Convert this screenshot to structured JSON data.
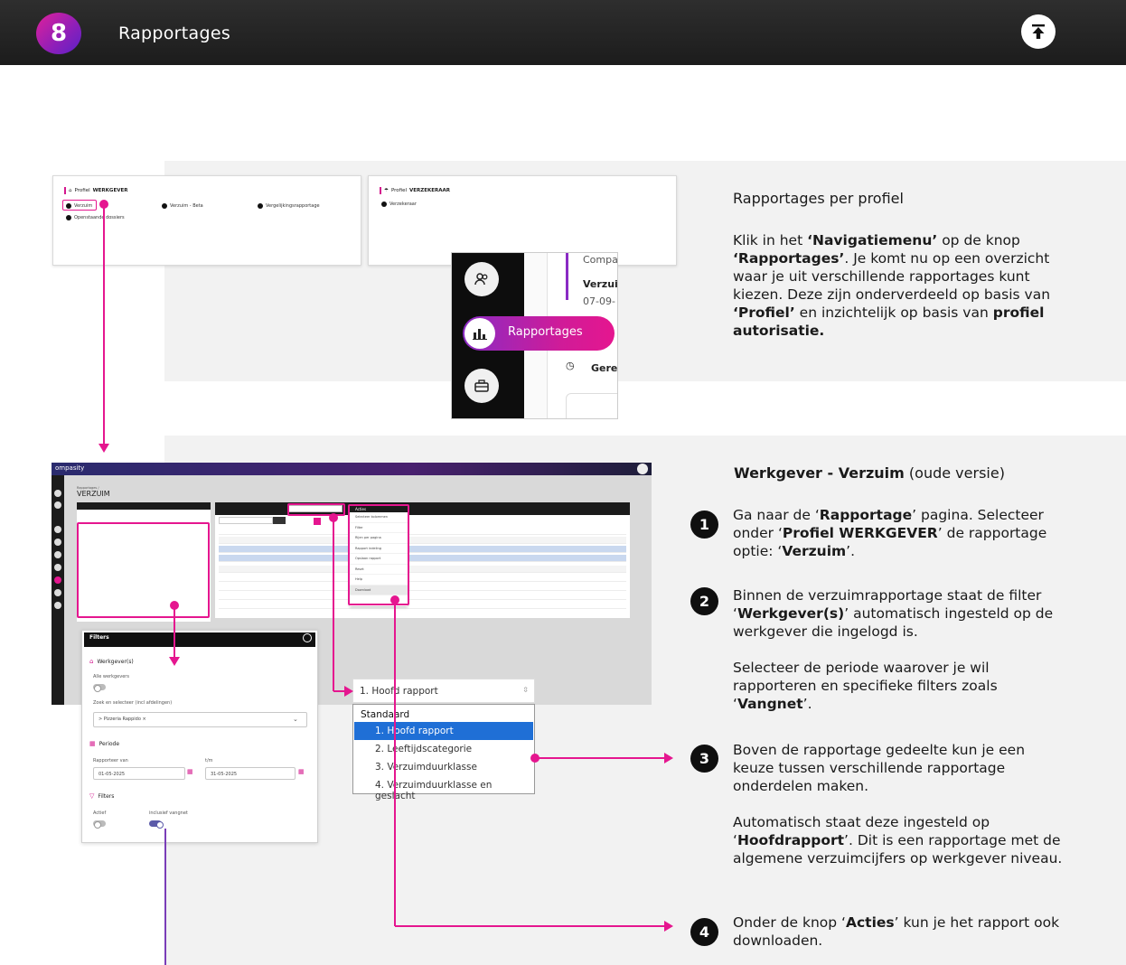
{
  "header": {
    "chapter": "8",
    "title": "Rapportages",
    "top_button_icon": "arrow-to-top-icon"
  },
  "colors": {
    "accent": "#e5168f",
    "header_bg": "#1f1f1f",
    "panel_bg": "#f2f2f2",
    "selected_blue": "#1f6fd6"
  },
  "profiles": {
    "werkgever": {
      "label_prefix": "Profiel",
      "label_name": "WERKGEVER",
      "reports": [
        "Verzuim",
        "Verzuim - Beta",
        "Vergelijkingsrapportage",
        "Openstaande dossiers"
      ]
    },
    "verzekeraar": {
      "label_prefix": "Profiel",
      "label_name": "VERZEKERAAR",
      "reports": [
        "Verzekeraar"
      ]
    }
  },
  "nav_zoom": {
    "active_item": "Rapportages",
    "background_texts": [
      "Compas",
      "Verzuim",
      "07-09-",
      "Gere"
    ]
  },
  "section1": {
    "heading": "Rapportages per profiel",
    "p": {
      "a": "Klik in het ",
      "b": "‘Navigatiemenu’",
      "c": " op de knop ",
      "d": "‘Rapportages’",
      "e": ". Je komt nu op een overzicht waar je uit verschillende rapportages kunt kiezen. Deze zijn onderverdeeld op basis van ",
      "f": "‘Profiel’",
      "g": " en inzichtelijk op basis van ",
      "h": "profiel autorisatie."
    }
  },
  "section2": {
    "heading_bold": "Werkgever - Verzuim",
    "heading_rest": " (oude versie)",
    "steps": [
      {
        "n": "1",
        "a": "Ga naar de ‘",
        "b": "Rapportage",
        "c": "’ pagina. Selecteer onder ‘",
        "d": "Profiel WERKGEVER",
        "e": "’ de rapportage optie: ‘",
        "f": "Verzuim",
        "g": "’."
      },
      {
        "n": "2",
        "a": "Binnen de verzuimrapportage staat de filter ‘",
        "b": "Werkgever(s)",
        "c": "’ automatisch ingesteld op de werkgever die ingelogd is.",
        "p2a": "Selecteer de periode waarover je wil rapporteren en specifieke filters zoals ‘",
        "p2b": "Vangnet",
        "p2c": "’."
      },
      {
        "n": "3",
        "a": "Boven de rapportage gedeelte kun je een keuze tussen verschillende rapportage onderdelen maken.",
        "p2a": "Automatisch staat deze ingesteld op ‘",
        "p2b": "Hoofdrapport",
        "p2c": "’. Dit is een rapportage met de algemene verzuimcijfers op werkgever niveau."
      },
      {
        "n": "4",
        "a": "Onder de knop ‘",
        "b": "Acties",
        "c": "’ kun je het rapport ook downloaden."
      }
    ]
  },
  "app": {
    "logo": "ompasity",
    "breadcrumb": "Rapportages /",
    "title": "VERZUIM",
    "acties_label": "Acties",
    "acties_items": [
      "Selecteer kolommen",
      "Filter",
      "Rijen per pagina",
      "Rapport indeling",
      "Opslaan rapport",
      "Reset",
      "Help",
      "Download"
    ]
  },
  "filters_zoom": {
    "title": "Filters",
    "werkgever_label": "Werkgever(s)",
    "alle_werkgevers": "Alle werkgevers",
    "zoek_label": "Zoek en selecteer (incl afdelingen)",
    "zoek_value": "> Pizzeria Rappido ×",
    "periode_label": "Periode",
    "rapporteer_van": "Rapporteer van",
    "tm": "t/m",
    "van_value": "01-05-2025",
    "tm_value": "31-05-2025",
    "filters_label": "Filters",
    "actief": "Actief",
    "vangnet": "inclusief vangnet"
  },
  "report_dropdown": {
    "selected": "1. Hoofd rapport",
    "group": "Standaard",
    "options": [
      "1. Hoofd rapport",
      "2. Leeftijdscategorie",
      "3. Verzuimduurklasse",
      "4. Verzuimduurklasse en geslacht"
    ]
  }
}
